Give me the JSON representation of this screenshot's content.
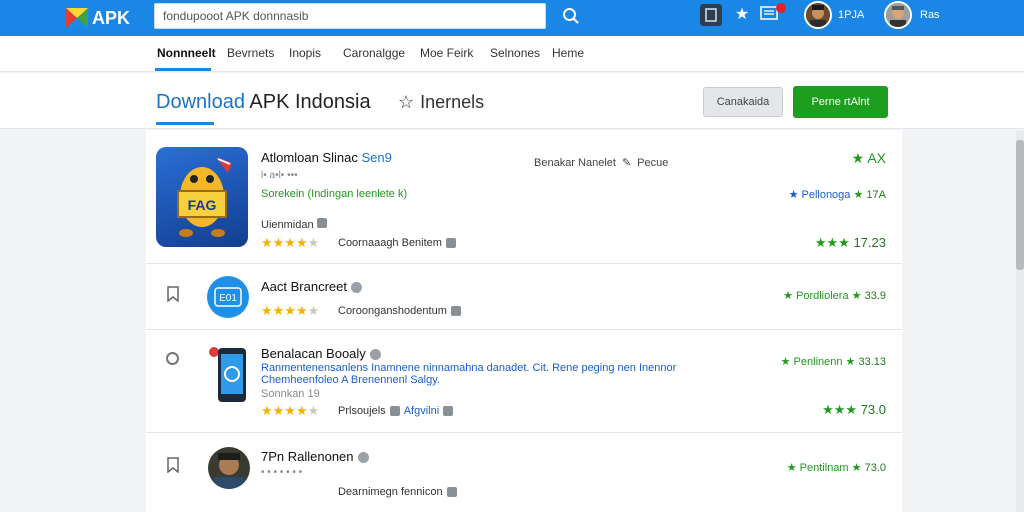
{
  "header": {
    "logo_text": "APK",
    "search": {
      "value": "fondupooot APK donnnasib",
      "placeholder": ""
    },
    "user_meta": "1PJA",
    "user_name": "Ras",
    "notif_color": "#e0242b",
    "brand_color": "#1a86e5"
  },
  "nav": {
    "items": [
      {
        "label": "Nonnneelt"
      },
      {
        "label": "Bevrnets"
      },
      {
        "label": "Inopis"
      },
      {
        "label": "Caronalgge"
      },
      {
        "label": "Moe Feirk"
      },
      {
        "label": "Selnones"
      },
      {
        "label": "Heme"
      }
    ]
  },
  "title": {
    "highlight": "Download",
    "rest": " APK Indonsia",
    "interest": "Inernels",
    "btn_secondary": "Canakaida",
    "btn_primary": "Perne rtAlnt"
  },
  "apps": [
    {
      "name": "Atlomloan Slinac",
      "name_tag": "Sen9",
      "meta_small": "l• a•l• •••",
      "sub_green": "Sorekein (Indingan leenlete k)",
      "developer": "Uienmidan",
      "dev_label": "Benakar Nanelet",
      "dev_label2": "Pecue",
      "category": "Coornaaagh Benitem",
      "rating": 4,
      "right_top": "AX",
      "right_mid_label": "Pellonoga",
      "right_mid_val": "17A",
      "right_bottom": "17.23"
    },
    {
      "name": "Aact Brancreet",
      "category": "Coroonganshodentum",
      "rating": 4,
      "right_label": "Pordliolera",
      "right_val": "33.9"
    },
    {
      "name": "Benalacan Booaly",
      "desc": "Ranmentenensanlens Inamnene ninnamahna danadet. Cit. Rene peging nen Inennor Chemheenfoleo A Brenennenl Salgy.",
      "developer": "Sonnkan 19",
      "category": "Prlsoujels",
      "category_tag": "Afgvilni",
      "rating": 4,
      "right_label": "Penlinenn",
      "right_val": "33.13",
      "right_bottom": "73.0"
    },
    {
      "name": "7Pn Rallenonen",
      "meta_small": "• • • • • • •",
      "category": "Dearnimegn fennicon",
      "right_label": "Pentilnam",
      "right_val": "73.0"
    }
  ]
}
